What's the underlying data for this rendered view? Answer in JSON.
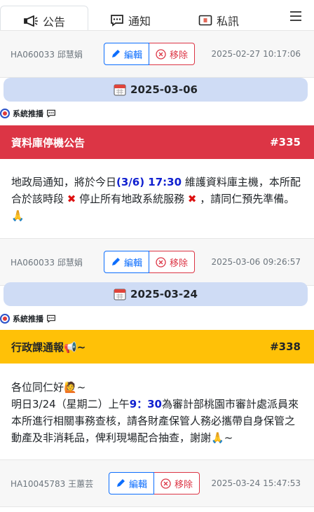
{
  "tabs": [
    {
      "label": "公告",
      "active": true
    },
    {
      "label": "通知",
      "active": false
    },
    {
      "label": "私訊",
      "active": false
    }
  ],
  "actions": {
    "edit": "編輯",
    "delete": "移除"
  },
  "top_footer": {
    "author": "HA060033 邱慧娟",
    "time": "2025-02-27 10:17:06"
  },
  "posts": [
    {
      "date": "2025-03-06",
      "source": "系統推播",
      "title": "資料庫停機公告",
      "number": "#335",
      "banner_color": "#dc3545",
      "body": {
        "p1": "地政局通知，將於今日",
        "h1": "(3/6) 17:30",
        "p2": " 維護資料庫主機，本所配合於該時段 ",
        "p3": " 停止所有地政系統服務 ",
        "p4": " ，請同仁預先準備。 ",
        "emoji_cross": "✖",
        "emoji_pray": "🙏"
      },
      "author": "HA060033 邱慧娟",
      "time": "2025-03-06 09:26:57"
    },
    {
      "date": "2025-03-24",
      "source": "系統推播",
      "title": "行政課通報",
      "title_emoji": "📢",
      "title_suffix": "~",
      "number": "#338",
      "banner_color": "#ffc107",
      "body": {
        "l1": "各位同仁好",
        "l1_emoji": "🙋",
        "l1_suffix": "~",
        "l2a": "明日3/24（星期二）上午",
        "h1": "9：30",
        "l2b": "為審計部桃園市審計處派員來本所進行相關事務查核，請各財產保管人務必攜帶自身保管之動產及非消耗品，俾利現場配合抽查，謝謝",
        "pray": "🙏",
        "end": "~"
      },
      "author": "HA10045783 王蕙芸",
      "time": "2025-03-24 15:47:53"
    }
  ]
}
